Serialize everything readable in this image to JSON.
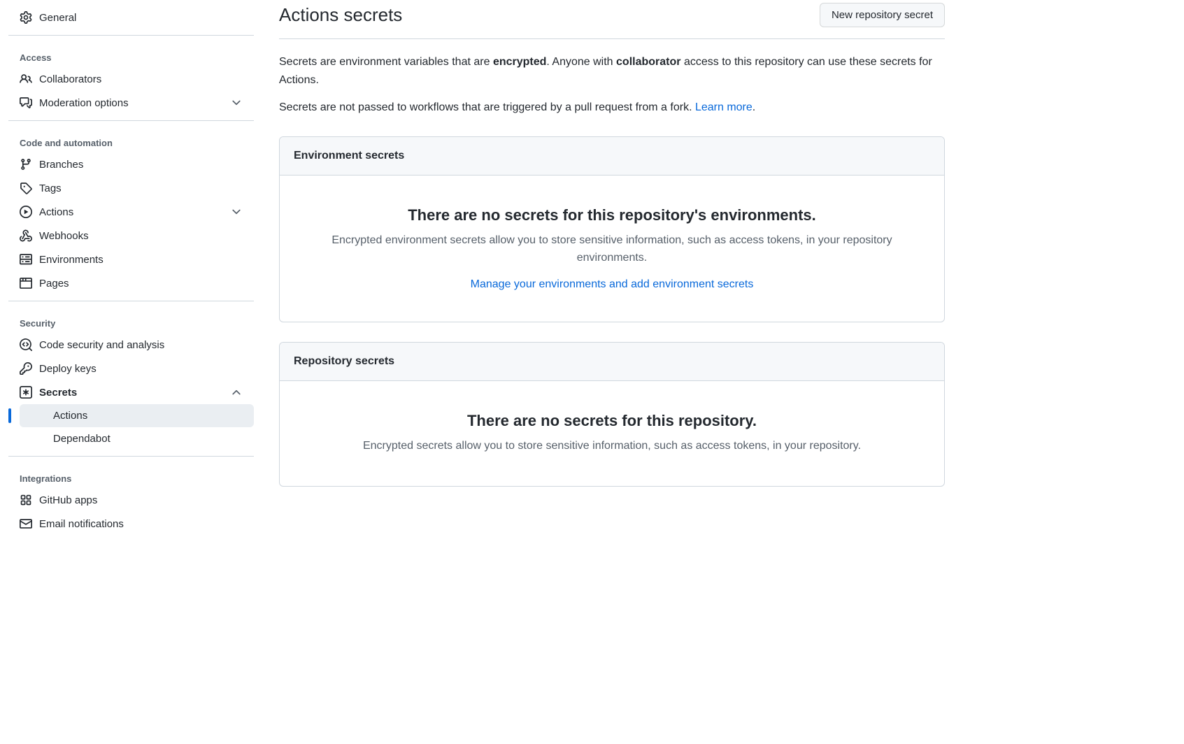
{
  "sidebar": {
    "general": "General",
    "sections": {
      "access": {
        "heading": "Access",
        "items": {
          "collaborators": "Collaborators",
          "moderation": "Moderation options"
        }
      },
      "code": {
        "heading": "Code and automation",
        "items": {
          "branches": "Branches",
          "tags": "Tags",
          "actions": "Actions",
          "webhooks": "Webhooks",
          "environments": "Environments",
          "pages": "Pages"
        }
      },
      "security": {
        "heading": "Security",
        "items": {
          "codesec": "Code security and analysis",
          "deploykeys": "Deploy keys",
          "secrets": "Secrets",
          "secrets_sub": {
            "actions": "Actions",
            "dependabot": "Dependabot"
          }
        }
      },
      "integrations": {
        "heading": "Integrations",
        "items": {
          "githubapps": "GitHub apps",
          "email": "Email notifications"
        }
      }
    }
  },
  "page": {
    "title": "Actions secrets",
    "new_secret_btn": "New repository secret",
    "intro1_pre": "Secrets are environment variables that are ",
    "intro1_b1": "encrypted",
    "intro1_mid": ". Anyone with ",
    "intro1_b2": "collaborator",
    "intro1_post": " access to this repository can use these secrets for Actions.",
    "intro2_pre": "Secrets are not passed to workflows that are triggered by a pull request from a fork. ",
    "intro2_link": "Learn more",
    "intro2_post": "."
  },
  "env_panel": {
    "header": "Environment secrets",
    "empty_title": "There are no secrets for this repository's environments.",
    "empty_desc": "Encrypted environment secrets allow you to store sensitive information, such as access tokens, in your repository environments.",
    "link": "Manage your environments and add environment secrets"
  },
  "repo_panel": {
    "header": "Repository secrets",
    "empty_title": "There are no secrets for this repository.",
    "empty_desc": "Encrypted secrets allow you to store sensitive information, such as access tokens, in your repository."
  }
}
